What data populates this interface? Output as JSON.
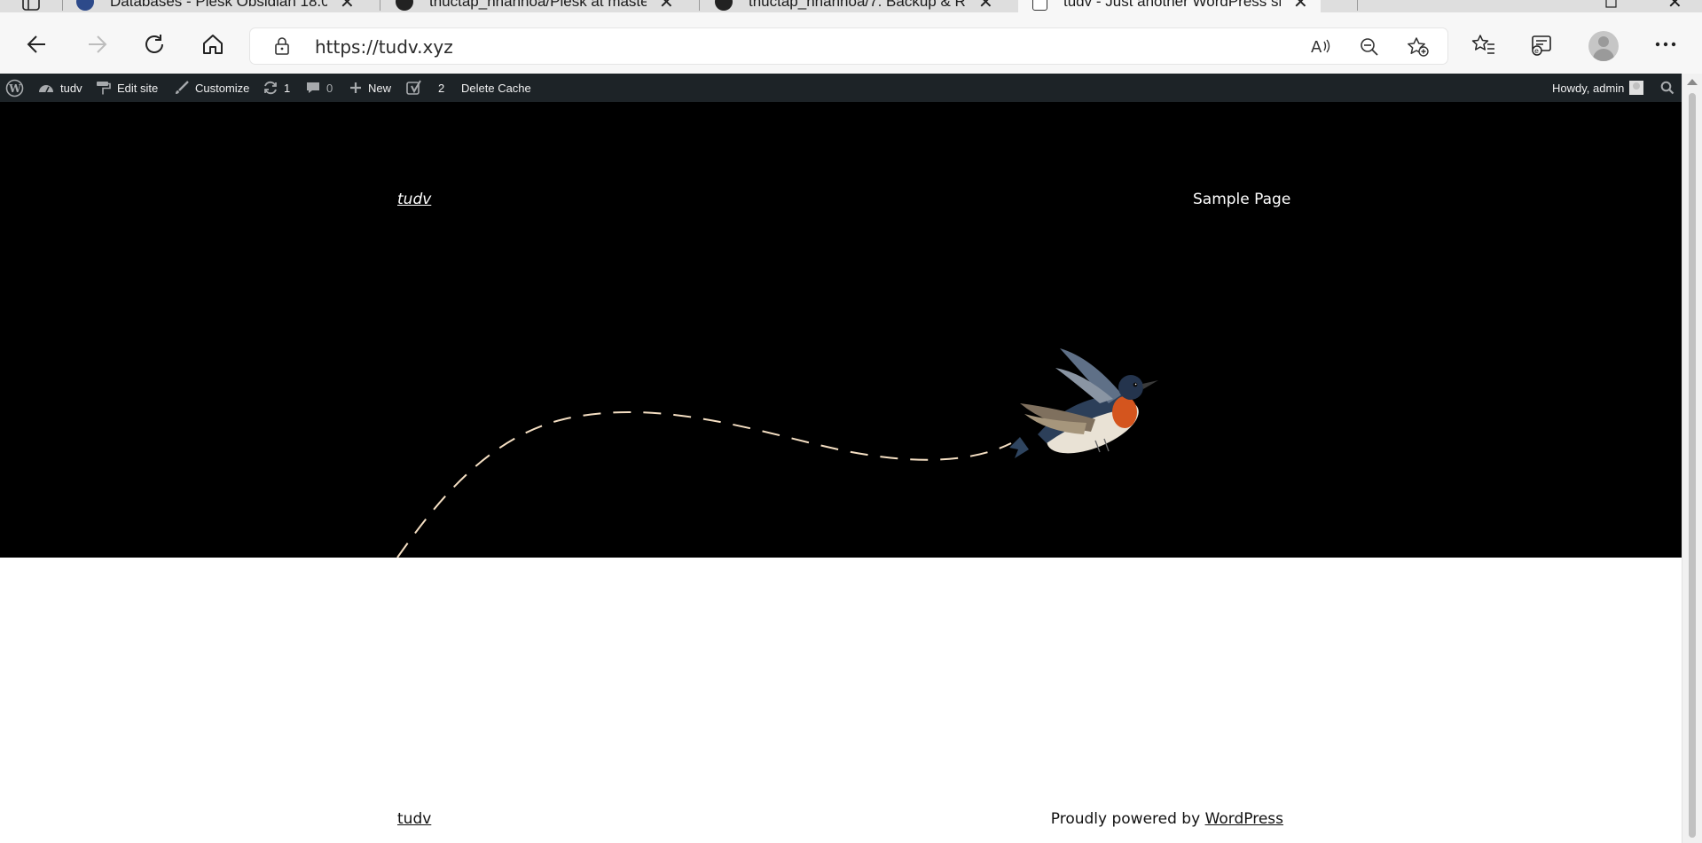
{
  "browser": {
    "tabs": [
      {
        "title": "Databases - Plesk Obsidian 18.0.",
        "favicon": "plesk-icon",
        "active": false
      },
      {
        "title": "thuctap_nhanhoa/Plesk at maste",
        "favicon": "github-icon",
        "active": false
      },
      {
        "title": "thuctap_nhanhoa/7. Backup & R",
        "favicon": "github-icon",
        "active": false
      },
      {
        "title": "tudv - Just another WordPress si",
        "favicon": "page-icon",
        "active": true
      }
    ],
    "url": "https://tudv.xyz"
  },
  "admin_bar": {
    "site_name": "tudv",
    "edit_site": "Edit site",
    "customize": "Customize",
    "updates_count": "1",
    "comments_count": "0",
    "new_label": "New",
    "yoast_count": "2",
    "delete_cache": "Delete Cache",
    "howdy": "Howdy, admin"
  },
  "page": {
    "site_title": "tudv",
    "nav": [
      "Sample Page"
    ],
    "footer": {
      "site_title": "tudv",
      "credit_prefix": "Proudly powered by ",
      "credit_link": "WordPress"
    }
  },
  "colors": {
    "admin_bar_bg": "#1d2327",
    "hero_bg": "#000000",
    "flight_path": "#f5dfc3"
  }
}
